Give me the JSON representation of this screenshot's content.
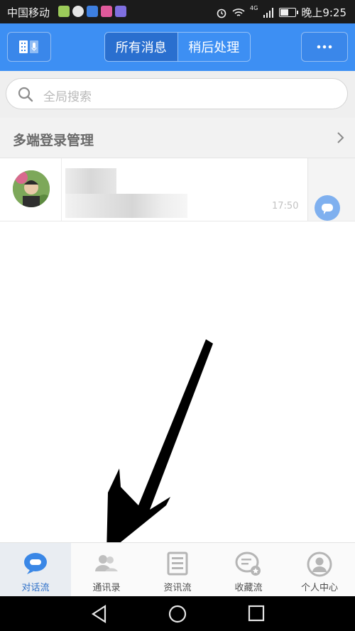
{
  "status_bar": {
    "carrier": "中国移动",
    "network": "4G",
    "time": "晚上9:25",
    "battery_level": 0.55
  },
  "header": {
    "tabs": [
      {
        "label": "所有消息",
        "active": true
      },
      {
        "label": "稍后处理",
        "active": false
      }
    ],
    "left_button_icon": "dial-mic-icon",
    "right_button_icon": "more-dots-icon"
  },
  "search": {
    "placeholder": "全局搜索"
  },
  "multi_device": {
    "label": "多端登录管理"
  },
  "conversation": {
    "time": "17:50"
  },
  "tabbar": {
    "items": [
      {
        "label": "对话流",
        "icon": "chat-bubble-icon",
        "active": true
      },
      {
        "label": "通讯录",
        "icon": "contacts-icon",
        "active": false
      },
      {
        "label": "资讯流",
        "icon": "news-icon",
        "active": false
      },
      {
        "label": "收藏流",
        "icon": "favorites-icon",
        "active": false
      },
      {
        "label": "个人中心",
        "icon": "profile-icon",
        "active": false
      }
    ]
  },
  "colors": {
    "header_blue": "#3d8ff3",
    "active_tab_text": "#2d6fc8"
  }
}
